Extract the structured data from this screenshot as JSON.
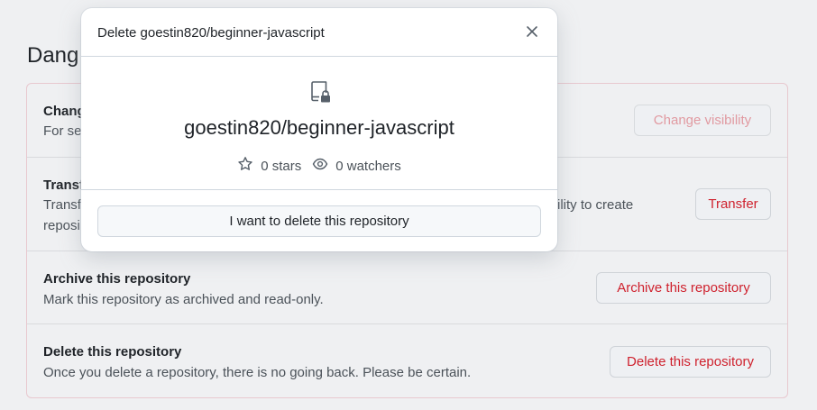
{
  "page": {
    "heading": "Dang"
  },
  "danger_zone": {
    "rows": [
      {
        "title": "Chang",
        "description": "For se",
        "button_label": "Change visibility"
      },
      {
        "title": "Transf",
        "description_line1": "Transf",
        "description_line1_tail": "ility to create",
        "description_line2": "reposi",
        "button_label": "Transfer"
      },
      {
        "title": "Archive this repository",
        "description": "Mark this repository as archived and read-only.",
        "button_label": "Archive this repository"
      },
      {
        "title": "Delete this repository",
        "description": "Once you delete a repository, there is no going back. Please be certain.",
        "button_label": "Delete this repository"
      }
    ]
  },
  "modal": {
    "title": "Delete goestin820/beginner-javascript",
    "repo_name": "goestin820/beginner-javascript",
    "stars": "0 stars",
    "watchers": "0 watchers",
    "confirm_label": "I want to delete this repository"
  },
  "icons": {
    "close": "close-icon",
    "repo": "repo-locked-icon",
    "star": "star-icon",
    "eye": "eye-icon"
  },
  "colors": {
    "danger": "#cf222e",
    "danger_disabled": "#e19aa1",
    "danger_border": "#e8c8cf"
  }
}
